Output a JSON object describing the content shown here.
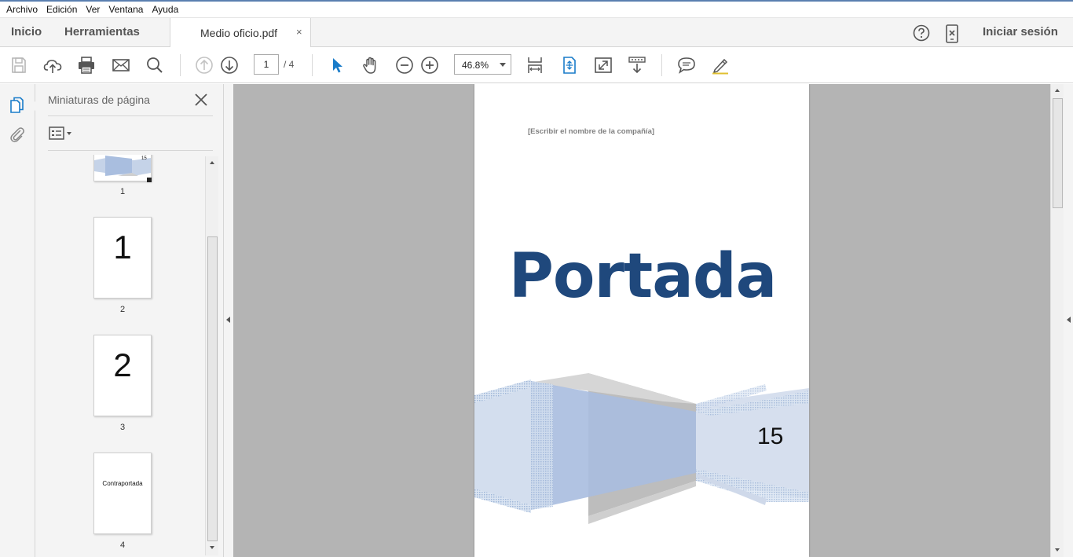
{
  "menu": [
    "Archivo",
    "Edición",
    "Ver",
    "Ventana",
    "Ayuda"
  ],
  "tabs": {
    "home": "Inicio",
    "tools": "Herramientas",
    "document": "Medio oficio.pdf",
    "close_glyph": "×",
    "sign_in": "Iniciar sesión"
  },
  "toolbar": {
    "current_page": "1",
    "total_pages": "/  4",
    "zoom": "46.8%",
    "accent_color": "#1a7cc9"
  },
  "thumbnails_panel": {
    "title": "Miniaturas de página",
    "thumbnails": [
      {
        "page": "1",
        "content": "15"
      },
      {
        "page": "2",
        "content": "1"
      },
      {
        "page": "3",
        "content": "2"
      },
      {
        "page": "4",
        "content": "Contraportada"
      }
    ]
  },
  "document": {
    "company_placeholder": "[Escribir el nombre de la compañía]",
    "title": "Portada",
    "page_number": "15",
    "title_color": "#1f487c"
  }
}
